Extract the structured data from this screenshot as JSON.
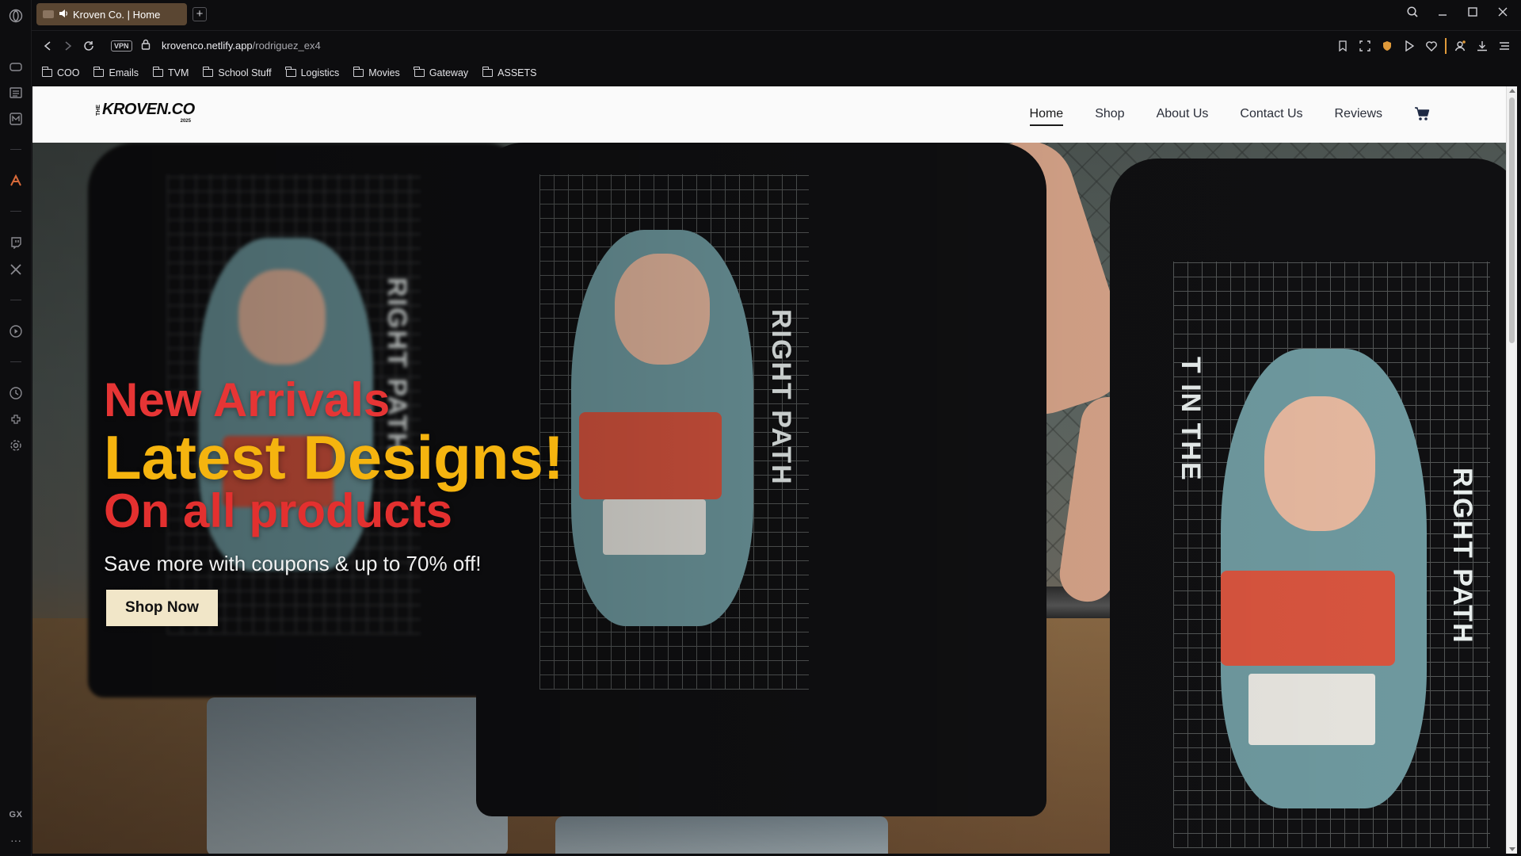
{
  "browser": {
    "tab": {
      "title": "Kroven Co. | Home",
      "audio_icon": "speaker-icon"
    },
    "new_tab_label": "+",
    "vpn_label": "VPN",
    "url_domain": "krovenco.netlify.app",
    "url_path": "/rodriguez_ex4",
    "bookmarks": [
      "COO",
      "Emails",
      "TVM",
      "School Stuff",
      "Logistics",
      "Movies",
      "Gateway",
      "ASSETS"
    ],
    "sidebar_badge": "GX",
    "sidebar_more": "···",
    "accent_color": "#e09a3a"
  },
  "site": {
    "logo": {
      "prefix": "THE",
      "word": "KROVEN.CO",
      "year": "2025"
    },
    "nav": [
      "Home",
      "Shop",
      "About Us",
      "Contact Us",
      "Reviews"
    ],
    "active_nav": "Home",
    "cart_icon": "cart-icon"
  },
  "hero": {
    "line1": "New Arrivals",
    "line2": "Latest Designs!",
    "line3": "On all products",
    "subtitle": "Save more with coupons & up to 70% off!",
    "cta": "Shop Now",
    "colors": {
      "red": "#e63535",
      "yellow": "#f5b40f",
      "button": "#f1e6c8"
    }
  }
}
